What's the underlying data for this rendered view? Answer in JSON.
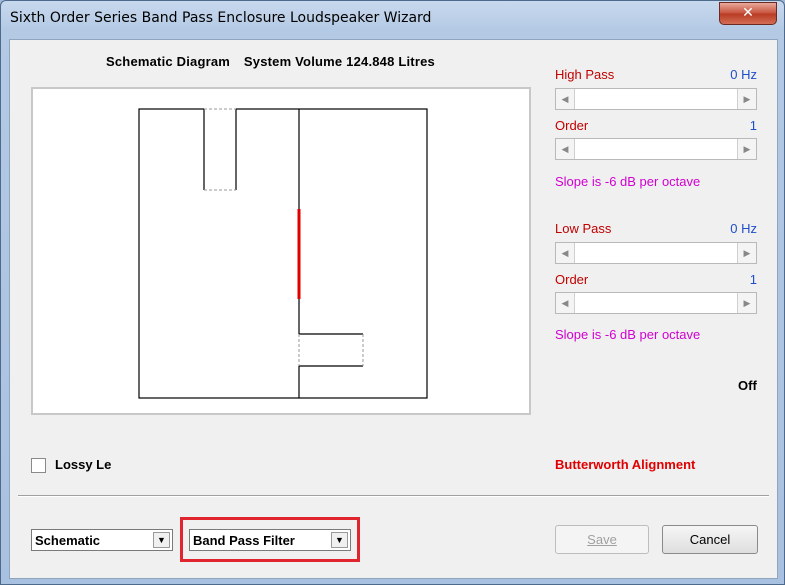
{
  "window": {
    "title": "Sixth Order Series Band Pass Enclosure Loudspeaker Wizard",
    "close_glyph": "✕"
  },
  "header": {
    "schematic_label": "Schematic Diagram",
    "volume_text": "System Volume 124.848 Litres"
  },
  "high_pass": {
    "label": "High Pass",
    "value": "0 Hz",
    "order_label": "Order",
    "order_value": "1",
    "slope": "Slope is -6 dB per octave"
  },
  "low_pass": {
    "label": "Low Pass",
    "value": "0 Hz",
    "order_label": "Order",
    "order_value": "1",
    "slope": "Slope is -6 dB per octave"
  },
  "status": {
    "off": "Off",
    "alignment": "Butterworth Alignment"
  },
  "options": {
    "lossy_label": "Lossy Le",
    "lossy_checked": false
  },
  "footer": {
    "view_select": "Schematic",
    "filter_select": "Band Pass Filter",
    "save_label": "Save",
    "cancel_label": "Cancel"
  },
  "icons": {
    "left_arrow": "◀",
    "right_arrow": "▶",
    "dropdown": "▼"
  },
  "colors": {
    "driver": "#e00000",
    "highlight": "#e0252f"
  }
}
